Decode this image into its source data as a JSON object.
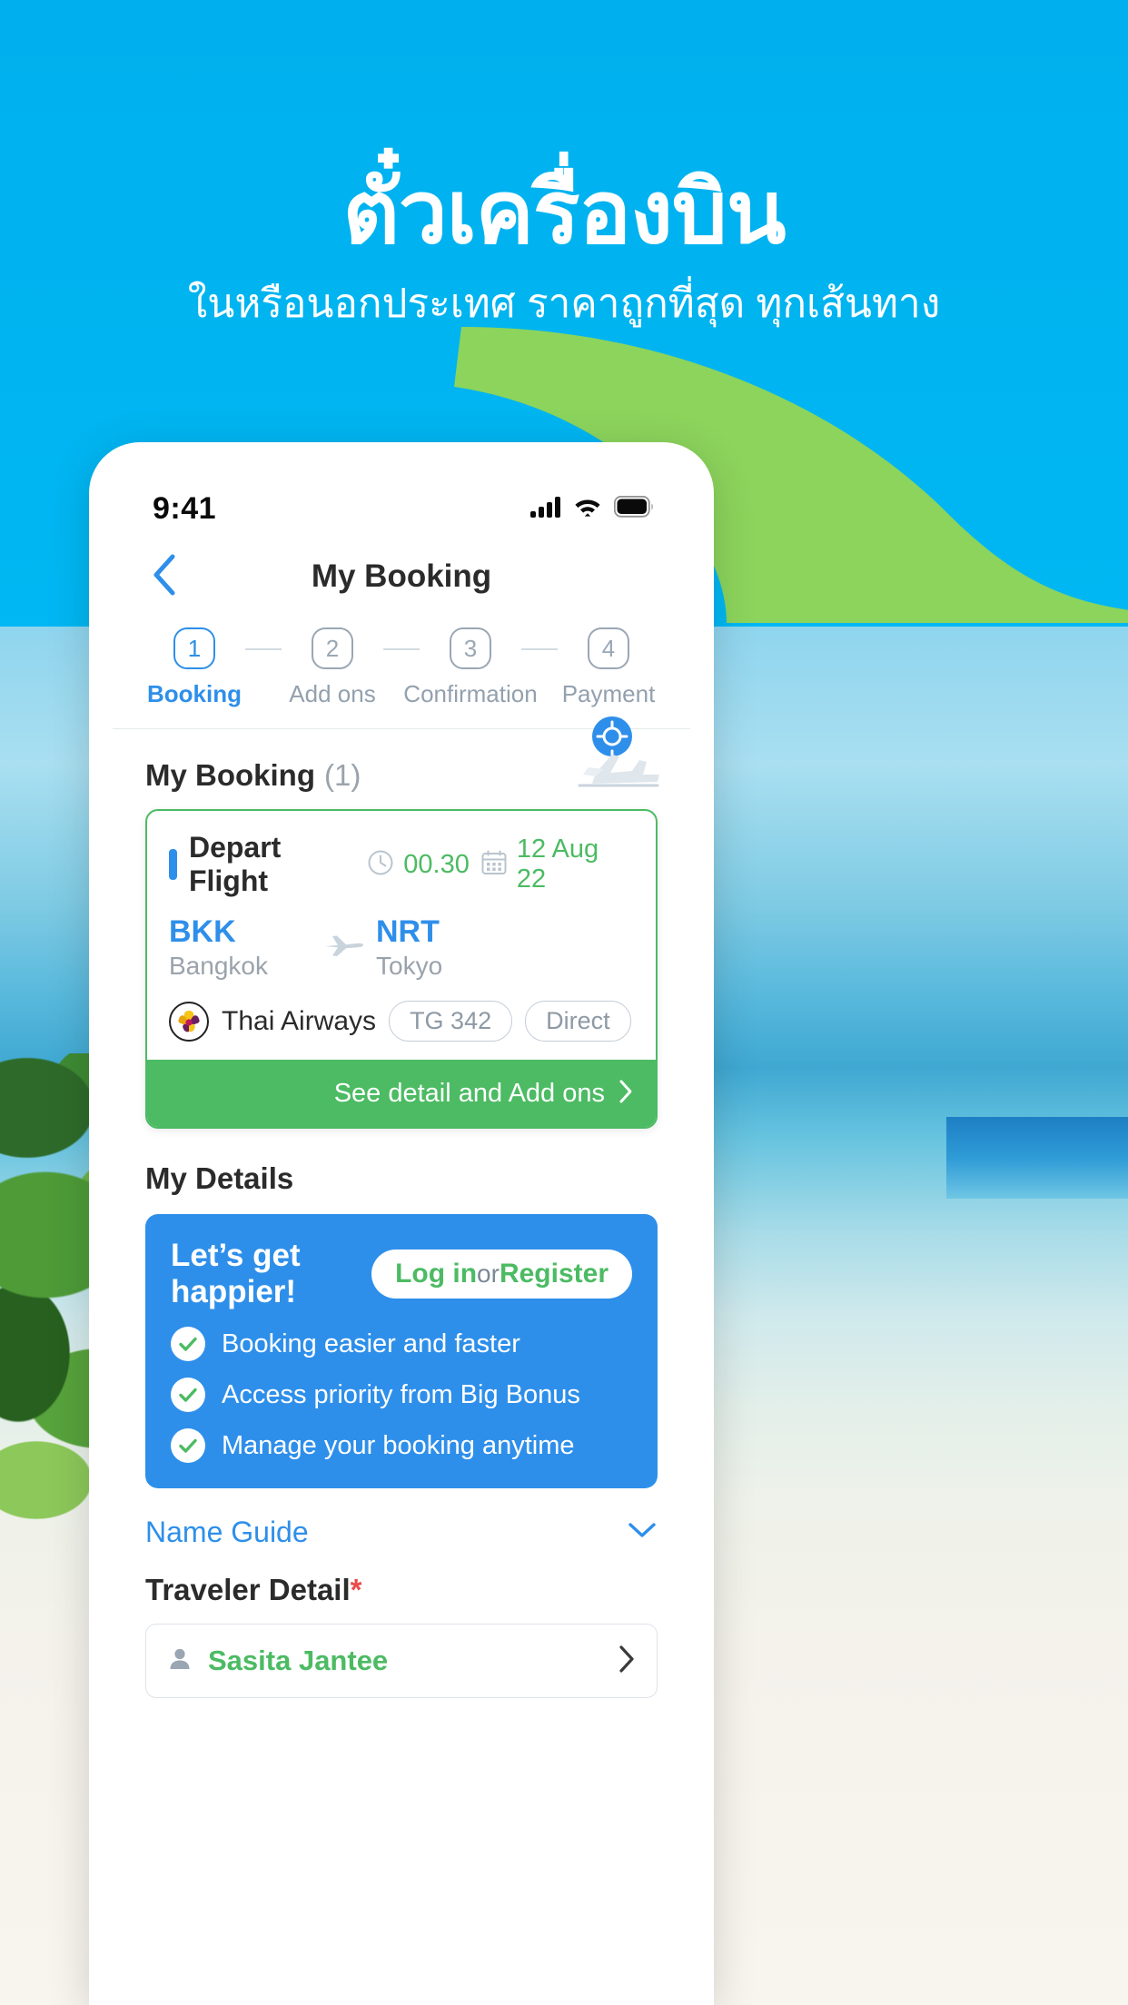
{
  "hero": {
    "title": "ตั๋วเครื่องบิน",
    "subtitle": "ในหรือนอกประเทศ ราคาถูกที่สุด ทุกเส้นทาง"
  },
  "colors": {
    "sky": "#00B4F0",
    "green": "#4CBB63",
    "blue": "#2E8FEA",
    "swoosh_green": "#8CD45C",
    "required_red": "#EA4B4B"
  },
  "statusbar": {
    "time": "9:41",
    "icons": [
      "cellular-signal-icon",
      "wifi-icon",
      "battery-icon"
    ]
  },
  "navbar": {
    "back_icon": "chevron-left-icon",
    "title": "My Booking"
  },
  "stepper": {
    "steps": [
      {
        "number": "1",
        "label": "Booking",
        "active": true
      },
      {
        "number": "2",
        "label": "Add ons",
        "active": false
      },
      {
        "number": "3",
        "label": "Confirmation",
        "active": false
      },
      {
        "number": "4",
        "label": "Payment",
        "active": false
      }
    ]
  },
  "booking_section": {
    "title": "My Booking",
    "count": "(1)",
    "decoration_icon": "airplane-takeoff-icon"
  },
  "flight_card": {
    "label": "Depart Flight",
    "time_icon": "clock-icon",
    "time": "00.30",
    "date_icon": "calendar-icon",
    "date": "12 Aug 22",
    "origin_code": "BKK",
    "origin_city": "Bangkok",
    "plane_icon": "airplane-right-icon",
    "destination_code": "NRT",
    "destination_city": "Tokyo",
    "airline_logo": "thai-airways-logo-icon",
    "airline_name": "Thai Airways",
    "flight_number": "TG 342",
    "stops": "Direct",
    "footer_label": "See detail and Add ons",
    "footer_icon": "chevron-right-icon"
  },
  "details_section": {
    "title": "My Details"
  },
  "promo": {
    "title": "Let’s get happier!",
    "login_label": "Log in",
    "or_label": "or",
    "register_label": "Register",
    "benefits": [
      "Booking easier and faster",
      "Access priority from Big Bonus",
      "Manage your booking anytime"
    ]
  },
  "name_guide": {
    "label": "Name Guide",
    "chevron_icon": "chevron-down-icon"
  },
  "traveler": {
    "title": "Traveler Detail",
    "required_mark": "*",
    "person_icon": "person-icon",
    "name": "Sasita Jantee",
    "chevron_icon": "chevron-right-icon"
  }
}
